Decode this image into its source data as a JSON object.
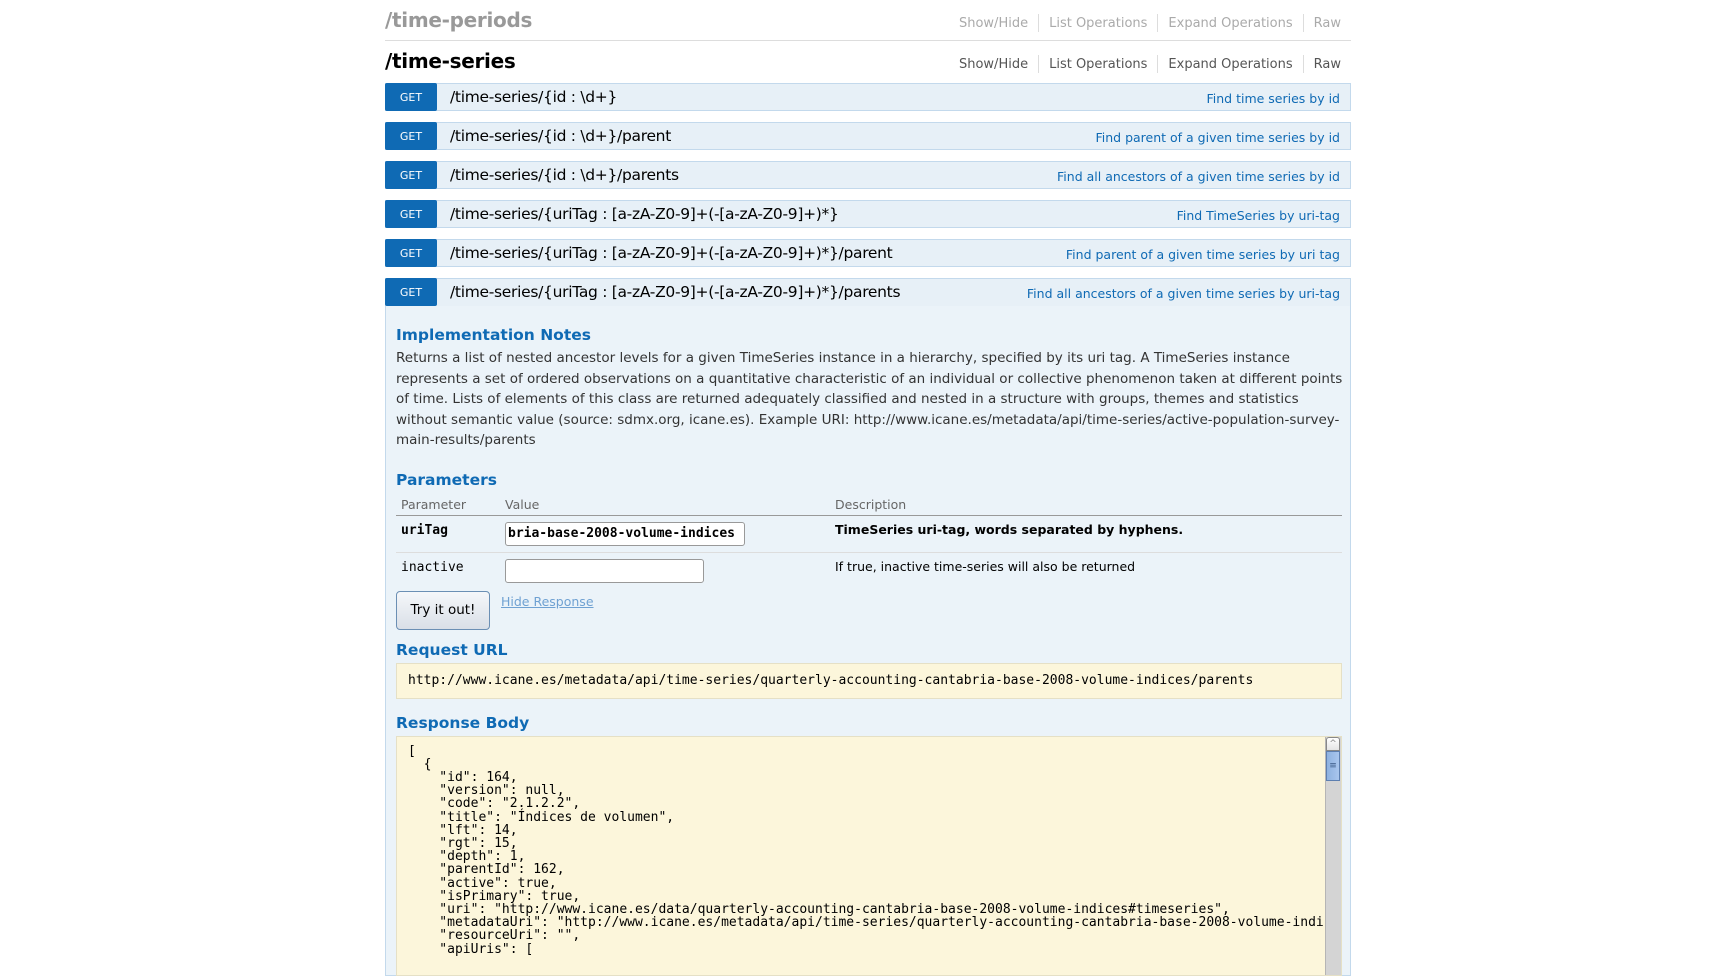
{
  "resources": [
    {
      "title": "/time-periods",
      "links": [
        "Show/Hide",
        "List Operations",
        "Expand Operations",
        "Raw"
      ]
    },
    {
      "title": "/time-series",
      "links": [
        "Show/Hide",
        "List Operations",
        "Expand Operations",
        "Raw"
      ]
    }
  ],
  "operations": [
    {
      "method": "GET",
      "path": "/time-series/{id : \\d+}",
      "summary": "Find time series by id"
    },
    {
      "method": "GET",
      "path": "/time-series/{id : \\d+}/parent",
      "summary": "Find parent of a given time series by id"
    },
    {
      "method": "GET",
      "path": "/time-series/{id : \\d+}/parents",
      "summary": "Find all ancestors of a given time series by id"
    },
    {
      "method": "GET",
      "path": "/time-series/{uriTag : [a-zA-Z0-9]+(-[a-zA-Z0-9]+)*}",
      "summary": "Find TimeSeries by uri-tag"
    },
    {
      "method": "GET",
      "path": "/time-series/{uriTag : [a-zA-Z0-9]+(-[a-zA-Z0-9]+)*}/parent",
      "summary": "Find parent of a given time series by uri tag"
    },
    {
      "method": "GET",
      "path": "/time-series/{uriTag : [a-zA-Z0-9]+(-[a-zA-Z0-9]+)*}/parents",
      "summary": "Find all ancestors of a given time series by uri-tag"
    }
  ],
  "details": {
    "notes_title": "Implementation Notes",
    "notes": "Returns a list of nested ancestor levels for a given TimeSeries instance in a hierarchy, specified by its uri tag. A TimeSeries instance represents a set of ordered observations on a quantitative characteristic of an individual or collective phenomenon taken at different points of time. Lists of elements of this class are returned adequately classified and nested in a structure with groups, themes and statistics without semantic value (source: sdmx.org, icane.es). Example URI: http://www.icane.es/metadata/api/time-series/active-population-survey-main-results/parents",
    "params_title": "Parameters",
    "param_headers": {
      "parameter": "Parameter",
      "value": "Value",
      "description": "Description"
    },
    "params": [
      {
        "name": "uriTag",
        "value": "bria-base-2008-volume-indices",
        "description": "TimeSeries uri-tag, words separated by hyphens."
      },
      {
        "name": "inactive",
        "value": "",
        "description": "If true, inactive time-series will also be returned"
      }
    ],
    "try_button": "Try it out!",
    "hide_response": "Hide Response",
    "request_url_title": "Request URL",
    "request_url": "http://www.icane.es/metadata/api/time-series/quarterly-accounting-cantabria-base-2008-volume-indices/parents",
    "response_body_title": "Response Body",
    "response_body": "[\n  {\n    \"id\": 164,\n    \"version\": null,\n    \"code\": \"2.1.2.2\",\n    \"title\": \"Índices de volumen\",\n    \"lft\": 14,\n    \"rgt\": 15,\n    \"depth\": 1,\n    \"parentId\": 162,\n    \"active\": true,\n    \"isPrimary\": true,\n    \"uri\": \"http://www.icane.es/data/quarterly-accounting-cantabria-base-2008-volume-indices#timeseries\",\n    \"metadataUri\": \"http://www.icane.es/metadata/api/time-series/quarterly-accounting-cantabria-base-2008-volume-indices\",\n    \"resourceUri\": \"\",\n    \"apiUris\": ["
  },
  "colors": {
    "method_get": "#0f6ab4",
    "op_background": "#e7f0f7",
    "panel_background": "#ebf3f9",
    "code_background": "#fcf6db"
  }
}
